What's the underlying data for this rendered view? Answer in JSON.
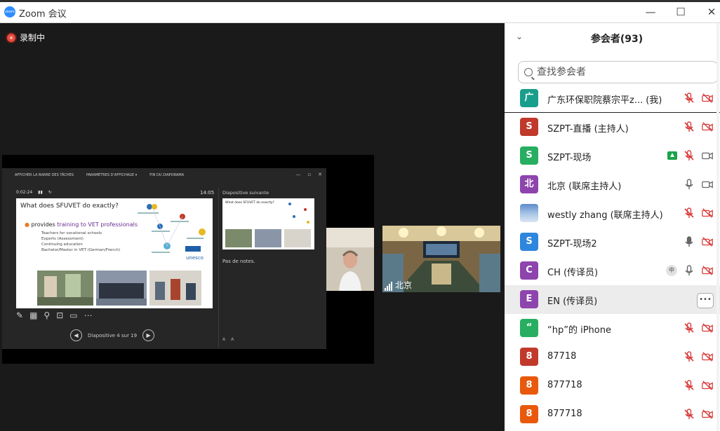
{
  "window": {
    "app_logo": "zoom",
    "title": "Zoom 会议",
    "minimize": "—",
    "maximize": "☐",
    "close": "✕"
  },
  "recording": {
    "label": "录制中"
  },
  "share": {
    "toolbar": [
      "AFFICHER LA BARRE DES TÂCHES",
      "PARAMÈTRES D'AFFICHAGE ▾",
      "FIN DU DIAPORAMA"
    ],
    "timer": "0:02:24",
    "clock": "14:05",
    "slide": {
      "title": "What does SFUVET do exactly?",
      "bullet_prefix": "provides ",
      "bullet_highlight": "training to VET professionals",
      "sub_items": [
        "Teachers for vocational schools",
        "Experts (Assessment)",
        "Continuing education",
        "Bachelor/Master in VET (German/French)"
      ],
      "logo": "unesco"
    },
    "next_label": "Diapositive suivante",
    "next_title": "What does SFUVET do exactly?",
    "notes": "Pas de notes.",
    "nav_label": "Diapositive 4 sur 19",
    "font_buttons": [
      "A",
      "A"
    ]
  },
  "video_room": {
    "label": "北京"
  },
  "panel": {
    "collapse_icon": "chevron-down",
    "title": "参会者(93)",
    "search_placeholder": "查找参会者",
    "participants": [
      {
        "initial": "广",
        "color": "#1a9e8c",
        "name": "广东环保职院蔡宗平z...",
        "suffix": "(我)",
        "raise": false,
        "badge": "",
        "mic": "muted",
        "video": "off"
      },
      {
        "initial": "S",
        "color": "#c0392b",
        "name": "SZPT-直播 (主持人)",
        "suffix": "",
        "raise": false,
        "badge": "",
        "mic": "muted",
        "video": "off"
      },
      {
        "initial": "S",
        "color": "#27ae60",
        "name": "SZPT-现场",
        "suffix": "",
        "raise": true,
        "badge": "",
        "mic": "muted",
        "video": "on"
      },
      {
        "initial": "北",
        "color": "#8e44ad",
        "name": "北京 (联席主持人)",
        "suffix": "",
        "raise": false,
        "badge": "",
        "mic": "on",
        "video": "on"
      },
      {
        "initial": "",
        "color": "photo",
        "name": "westly zhang (联席主持人)",
        "suffix": "",
        "raise": false,
        "badge": "",
        "mic": "muted",
        "video": "off"
      },
      {
        "initial": "S",
        "color": "#2e86de",
        "name": "SZPT-现场2",
        "suffix": "",
        "raise": false,
        "badge": "",
        "mic": "active",
        "video": "off"
      },
      {
        "initial": "C",
        "color": "#8e44ad",
        "name": "CH (传译员)",
        "suffix": "",
        "raise": false,
        "badge": "中",
        "mic": "on",
        "video": "off"
      },
      {
        "initial": "E",
        "color": "#8e44ad",
        "name": "EN (传译员)",
        "suffix": "",
        "raise": false,
        "badge": "",
        "mic": "more",
        "video": "more"
      },
      {
        "initial": "“",
        "color": "#27ae60",
        "name": "“hp”的 iPhone",
        "suffix": "",
        "raise": false,
        "badge": "",
        "mic": "muted",
        "video": "off"
      },
      {
        "initial": "8",
        "color": "#c0392b",
        "name": "87718",
        "suffix": "",
        "raise": false,
        "badge": "",
        "mic": "muted",
        "video": "off"
      },
      {
        "initial": "8",
        "color": "#e8590c",
        "name": "877718",
        "suffix": "",
        "raise": false,
        "badge": "",
        "mic": "muted",
        "video": "off"
      },
      {
        "initial": "8",
        "color": "#e8590c",
        "name": "877718",
        "suffix": "",
        "raise": false,
        "badge": "",
        "mic": "muted",
        "video": "off"
      }
    ]
  }
}
